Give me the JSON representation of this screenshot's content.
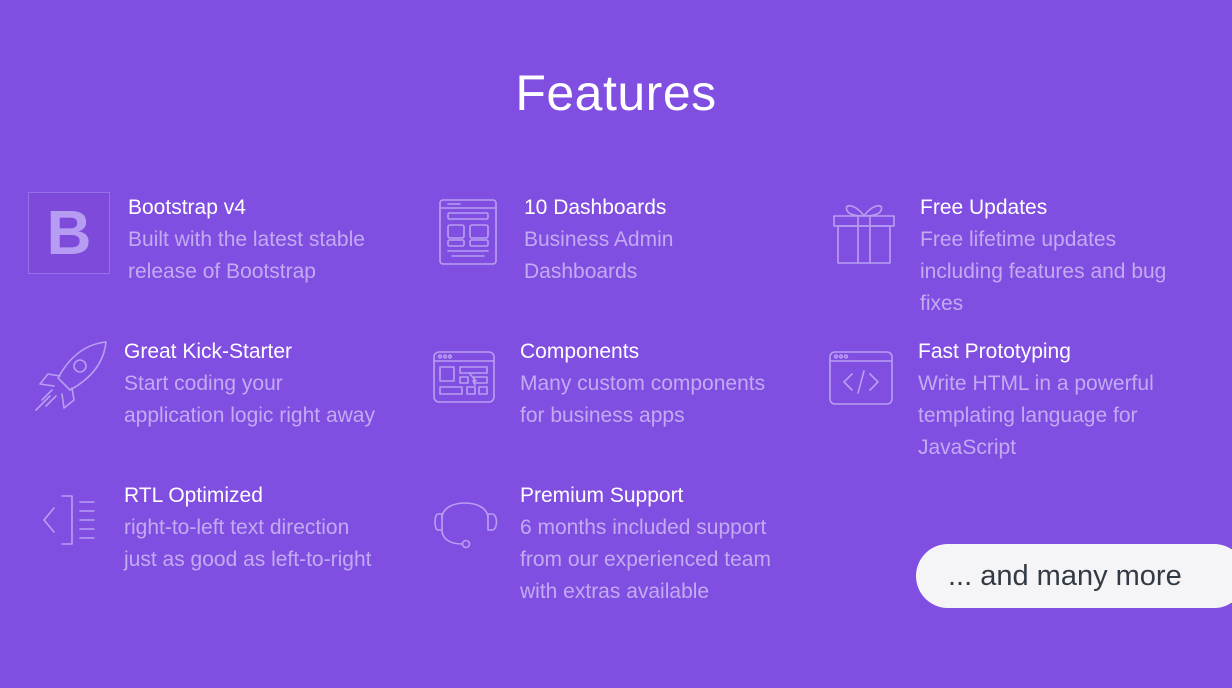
{
  "page": {
    "title": "Features"
  },
  "colors": {
    "background": "#804ee0",
    "title_text": "#ffffff",
    "description_text": "#c3aaf3",
    "icon_stroke": "#b99ef2",
    "pill_background": "#f5f5f7",
    "pill_text": "#333a44"
  },
  "features": [
    {
      "icon": "bootstrap-logo-icon",
      "icon_letter": "B",
      "title": "Bootstrap v4",
      "description_lines": [
        "Built with the latest stable",
        "release of Bootstrap"
      ]
    },
    {
      "icon": "dashboard-layout-icon",
      "title": "10 Dashboards",
      "description_lines": [
        "Business Admin",
        "Dashboards"
      ]
    },
    {
      "icon": "gift-icon",
      "title": "Free Updates",
      "description_lines": [
        "Free lifetime updates",
        "including features and bug",
        "fixes"
      ]
    },
    {
      "icon": "rocket-icon",
      "title": "Great Kick-Starter",
      "description_lines": [
        "Start coding your",
        "application logic right away"
      ]
    },
    {
      "icon": "browser-components-icon",
      "title": "Components",
      "description_lines": [
        "Many custom components",
        "for business apps"
      ]
    },
    {
      "icon": "browser-code-icon",
      "title": "Fast Prototyping",
      "description_lines": [
        "Write HTML in a powerful",
        "templating language for",
        "JavaScript"
      ]
    },
    {
      "icon": "rtl-text-icon",
      "title": "RTL Optimized",
      "description_lines": [
        "right-to-left text direction",
        "just as good as left-to-right"
      ]
    },
    {
      "icon": "headset-icon",
      "title": "Premium Support",
      "description_lines": [
        "6 months included support",
        "from our experienced team",
        "with extras available"
      ]
    }
  ],
  "more_button": {
    "label": "... and many more"
  }
}
